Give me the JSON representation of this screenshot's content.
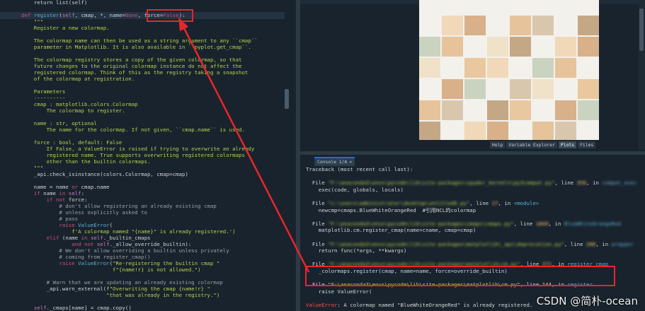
{
  "editor": {
    "lines": [
      {
        "segments": [
          {
            "t": "    return list(self)",
            "c": ""
          }
        ]
      },
      {
        "segments": [
          {
            "t": "",
            "c": ""
          }
        ]
      },
      {
        "segments": [
          {
            "t": "def ",
            "c": "kw"
          },
          {
            "t": "register",
            "c": "fn"
          },
          {
            "t": "(",
            "c": ""
          },
          {
            "t": "self",
            "c": "sf"
          },
          {
            "t": ", cmap, *, name=",
            "c": ""
          },
          {
            "t": "None",
            "c": "kw"
          },
          {
            "t": ", force=",
            "c": ""
          },
          {
            "t": "False",
            "c": "kw"
          },
          {
            "t": "):",
            "c": ""
          }
        ],
        "current": true
      },
      {
        "segments": [
          {
            "t": "    \"\"\"",
            "c": "st"
          }
        ]
      },
      {
        "segments": [
          {
            "t": "    Register a new colormap.",
            "c": "st"
          }
        ]
      },
      {
        "segments": [
          {
            "t": "",
            "c": ""
          }
        ]
      },
      {
        "segments": [
          {
            "t": "    The colormap name can then be used as a string argument to any ``cmap``",
            "c": "st"
          }
        ]
      },
      {
        "segments": [
          {
            "t": "    parameter in Matplotlib. It is also available in ``pyplot.get_cmap``.",
            "c": "st"
          }
        ]
      },
      {
        "segments": [
          {
            "t": "",
            "c": ""
          }
        ]
      },
      {
        "segments": [
          {
            "t": "    The colormap registry stores a copy of the given colormap, so that",
            "c": "st"
          }
        ]
      },
      {
        "segments": [
          {
            "t": "    future changes to the original colormap instance do not affect the",
            "c": "st"
          }
        ]
      },
      {
        "segments": [
          {
            "t": "    registered colormap. Think of this as the registry taking a snapshot",
            "c": "st"
          }
        ]
      },
      {
        "segments": [
          {
            "t": "    of the colormap at registration.",
            "c": "st"
          }
        ]
      },
      {
        "segments": [
          {
            "t": "",
            "c": ""
          }
        ]
      },
      {
        "segments": [
          {
            "t": "    Parameters",
            "c": "st"
          }
        ]
      },
      {
        "segments": [
          {
            "t": "    ----------",
            "c": "st"
          }
        ]
      },
      {
        "segments": [
          {
            "t": "    cmap : matplotlib.colors.Colormap",
            "c": "st"
          }
        ]
      },
      {
        "segments": [
          {
            "t": "        The colormap to register.",
            "c": "st"
          }
        ]
      },
      {
        "segments": [
          {
            "t": "",
            "c": ""
          }
        ]
      },
      {
        "segments": [
          {
            "t": "    name : str, optional",
            "c": "st"
          }
        ]
      },
      {
        "segments": [
          {
            "t": "        The name for the colormap. If not given, ``cmap.name`` is used.",
            "c": "st"
          }
        ]
      },
      {
        "segments": [
          {
            "t": "",
            "c": ""
          }
        ]
      },
      {
        "segments": [
          {
            "t": "    force : bool, default: False",
            "c": "st"
          }
        ]
      },
      {
        "segments": [
          {
            "t": "        If False, a ValueError is raised if trying to overwrite an already",
            "c": "st"
          }
        ]
      },
      {
        "segments": [
          {
            "t": "        registered name. True supports overwriting registered colormaps",
            "c": "st"
          }
        ]
      },
      {
        "segments": [
          {
            "t": "        other than the builtin colormaps.",
            "c": "st"
          }
        ]
      },
      {
        "segments": [
          {
            "t": "    \"\"\"",
            "c": "st"
          }
        ]
      },
      {
        "segments": [
          {
            "t": "    _api.check_isinstance(colors.Colormap, cmap=cmap)",
            "c": ""
          }
        ]
      },
      {
        "segments": [
          {
            "t": "",
            "c": ""
          }
        ]
      },
      {
        "segments": [
          {
            "t": "    name = name ",
            "c": ""
          },
          {
            "t": "or",
            "c": "kw"
          },
          {
            "t": " cmap.name",
            "c": ""
          }
        ]
      },
      {
        "segments": [
          {
            "t": "    ",
            "c": ""
          },
          {
            "t": "if",
            "c": "kw"
          },
          {
            "t": " name ",
            "c": ""
          },
          {
            "t": "in",
            "c": "kw"
          },
          {
            "t": " ",
            "c": ""
          },
          {
            "t": "self",
            "c": "sf"
          },
          {
            "t": ":",
            "c": ""
          }
        ]
      },
      {
        "segments": [
          {
            "t": "        ",
            "c": ""
          },
          {
            "t": "if not",
            "c": "kw"
          },
          {
            "t": " force:",
            "c": ""
          }
        ]
      },
      {
        "segments": [
          {
            "t": "            # don't allow registering an already existing cmap",
            "c": "cm"
          }
        ]
      },
      {
        "segments": [
          {
            "t": "            # unless explicitly asked to",
            "c": "cm"
          }
        ]
      },
      {
        "segments": [
          {
            "t": "            # pass",
            "c": "cm"
          }
        ]
      },
      {
        "segments": [
          {
            "t": "            ",
            "c": ""
          },
          {
            "t": "raise",
            "c": "kw"
          },
          {
            "t": " ",
            "c": ""
          },
          {
            "t": "ValueError",
            "c": "fn"
          },
          {
            "t": "(",
            "c": ""
          }
        ]
      },
      {
        "segments": [
          {
            "t": "                f'A colormap named \"{name}\" is already registered.')",
            "c": "st"
          }
        ]
      },
      {
        "segments": [
          {
            "t": "        ",
            "c": ""
          },
          {
            "t": "elif",
            "c": "kw"
          },
          {
            "t": " (name ",
            "c": ""
          },
          {
            "t": "in",
            "c": "kw"
          },
          {
            "t": " ",
            "c": ""
          },
          {
            "t": "self",
            "c": "sf"
          },
          {
            "t": "._builtin_cmaps",
            "c": ""
          }
        ]
      },
      {
        "segments": [
          {
            "t": "                ",
            "c": ""
          },
          {
            "t": "and not",
            "c": "kw"
          },
          {
            "t": " ",
            "c": ""
          },
          {
            "t": "self",
            "c": "sf"
          },
          {
            "t": "._allow_override_builtin):",
            "c": ""
          }
        ]
      },
      {
        "segments": [
          {
            "t": "            # We don't allow overriding a builtin unless privately",
            "c": "cm"
          }
        ]
      },
      {
        "segments": [
          {
            "t": "            # coming from register_cmap()",
            "c": "cm"
          }
        ]
      },
      {
        "segments": [
          {
            "t": "            ",
            "c": ""
          },
          {
            "t": "raise",
            "c": "kw"
          },
          {
            "t": " ",
            "c": ""
          },
          {
            "t": "ValueError",
            "c": "fn"
          },
          {
            "t": "(",
            "c": ""
          },
          {
            "t": "\"Re-registering the builtin cmap \"",
            "c": "st"
          }
        ]
      },
      {
        "segments": [
          {
            "t": "                             f\"{name!r} is not allowed.\")",
            "c": "st"
          }
        ]
      },
      {
        "segments": [
          {
            "t": "",
            "c": ""
          }
        ]
      },
      {
        "segments": [
          {
            "t": "        # Warn that we are updating an already existing colormap",
            "c": "cm"
          }
        ]
      },
      {
        "segments": [
          {
            "t": "        _api.warn_external(",
            "c": ""
          },
          {
            "t": "f\"Overwriting the cmap {name!r} \"",
            "c": "st"
          }
        ]
      },
      {
        "segments": [
          {
            "t": "                           ",
            "c": ""
          },
          {
            "t": "\"that was already in the registry.\")",
            "c": "st"
          },
          {
            "t": "",
            "c": ""
          }
        ]
      },
      {
        "segments": [
          {
            "t": "",
            "c": ""
          }
        ]
      },
      {
        "segments": [
          {
            "t": "    ",
            "c": ""
          },
          {
            "t": "self",
            "c": "sf"
          },
          {
            "t": "._cmaps[name] = cmap.copy()",
            "c": ""
          }
        ]
      }
    ]
  },
  "plots_pane": {
    "tabs": [
      {
        "label": "Help",
        "active": false
      },
      {
        "label": "Variable Explorer",
        "active": false
      },
      {
        "label": "Plots",
        "active": true
      },
      {
        "label": "Files",
        "active": false
      }
    ],
    "colors": [
      "#e9c8a0",
      "#f1d8b8",
      "#d8b08a",
      "#c9d3c0",
      "#e6c39a",
      "#d9c7ad",
      "#f0e2c9",
      "#c4a886"
    ]
  },
  "console": {
    "tab_label": "Console 1/A",
    "close_glyph": "×",
    "lines": [
      {
        "segments": [
          {
            "t": "Traceback (most recent call last):",
            "c": ""
          }
        ]
      },
      {
        "segments": [
          {
            "t": "",
            "c": ""
          }
        ]
      },
      {
        "segments": [
          {
            "t": "  File ",
            "c": ""
          },
          {
            "t": "\"F:\\anaconda3\\envs\\pycode\\lib\\site-packages\\spyder_kernels\\py3compat.py\"",
            "c": "st blur"
          },
          {
            "t": ", line ",
            "c": ""
          },
          {
            "t": "356",
            "c": "num blur"
          },
          {
            "t": ", in ",
            "c": ""
          },
          {
            "t": "compat_exec",
            "c": "fn blur"
          }
        ]
      },
      {
        "segments": [
          {
            "t": "    exec(code, globals, locals)",
            "c": ""
          }
        ]
      },
      {
        "segments": [
          {
            "t": "",
            "c": ""
          }
        ]
      },
      {
        "segments": [
          {
            "t": "  File ",
            "c": ""
          },
          {
            "t": "\"c:\\users\\administrator\\desktop\\untitled0.py\"",
            "c": "st blur"
          },
          {
            "t": ", line ",
            "c": ""
          },
          {
            "t": "17",
            "c": "num blur"
          },
          {
            "t": ", in ",
            "c": ""
          },
          {
            "t": "<module>",
            "c": "fn"
          }
        ]
      },
      {
        "segments": [
          {
            "t": "    newcmp=cmaps.BlueWhiteOrangeRed  #引用NCL的colormap",
            "c": ""
          }
        ]
      },
      {
        "segments": [
          {
            "t": "",
            "c": ""
          }
        ]
      },
      {
        "segments": [
          {
            "t": "  File ",
            "c": ""
          },
          {
            "t": "\"F:\\anaconda3\\envs\\pycode\\lib\\site-packages\\cmaps\\cmaps.py\"",
            "c": "st blur"
          },
          {
            "t": ", line ",
            "c": ""
          },
          {
            "t": "1009",
            "c": "num blur"
          },
          {
            "t": ", in ",
            "c": ""
          },
          {
            "t": "BlueWhiteOrangeRed",
            "c": "fn blur"
          }
        ]
      },
      {
        "segments": [
          {
            "t": "    matplotlib.cm.register_cmap(name=cname, cmap=cmap)",
            "c": ""
          }
        ]
      },
      {
        "segments": [
          {
            "t": "",
            "c": ""
          }
        ]
      },
      {
        "segments": [
          {
            "t": "  File ",
            "c": ""
          },
          {
            "t": "\"F:\\anaconda3\\envs\\pycode\\lib\\site-packages\\matplotlib\\_api\\deprecation.py\"",
            "c": "st blur"
          },
          {
            "t": ", line ",
            "c": ""
          },
          {
            "t": "200",
            "c": "num blur"
          },
          {
            "t": ", in ",
            "c": ""
          },
          {
            "t": "wrapper",
            "c": "fn blur"
          }
        ]
      },
      {
        "segments": [
          {
            "t": "    return func(*args, **kwargs)",
            "c": ""
          }
        ]
      },
      {
        "segments": [
          {
            "t": "",
            "c": ""
          }
        ]
      },
      {
        "segments": [
          {
            "t": "  File ",
            "c": ""
          },
          {
            "t": "\"F:\\anaconda3\\envs\\pycode\\lib\\site-packages\\matplotlib\\cm.py\"",
            "c": "st blur"
          },
          {
            "t": ", line ",
            "c": ""
          },
          {
            "t": "271",
            "c": "num blur"
          },
          {
            "t": ", in ",
            "c": ""
          },
          {
            "t": "register_cmap",
            "c": "fn"
          }
        ]
      },
      {
        "segments": [
          {
            "t": "    _colormaps.register(cmap, name=name, force=override_builtin)",
            "c": ""
          }
        ]
      },
      {
        "segments": [
          {
            "t": "",
            "c": ""
          }
        ]
      },
      {
        "segments": [
          {
            "t": "  File ",
            "c": ""
          },
          {
            "t": "\"F:\\anaconda3\\envs\\pycode\\lib\\site-packages\\matplotlib\\cm.py\"",
            "c": "st"
          },
          {
            "t": ", line ",
            "c": ""
          },
          {
            "t": "144",
            "c": "num"
          },
          {
            "t": ", in ",
            "c": ""
          },
          {
            "t": "register",
            "c": "fn"
          }
        ]
      },
      {
        "segments": [
          {
            "t": "    raise ValueError(",
            "c": ""
          }
        ]
      },
      {
        "segments": [
          {
            "t": "",
            "c": ""
          }
        ]
      },
      {
        "segments": [
          {
            "t": "ValueError",
            "c": "err"
          },
          {
            "t": ": A colormap named \"BlueWhiteOrangeRed\" is already registered.",
            "c": ""
          }
        ]
      }
    ]
  },
  "watermark": "CSDN @简朴-ocean"
}
